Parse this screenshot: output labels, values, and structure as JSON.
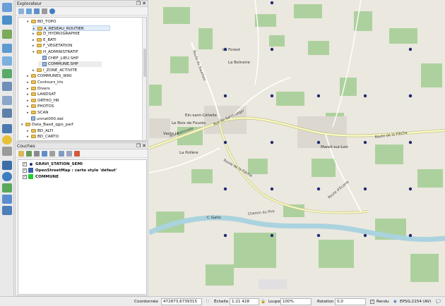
{
  "explorer": {
    "title": "Explorateur",
    "items": [
      {
        "label": "BD_TOPO",
        "indent": 1,
        "type": "folder",
        "arrow": "▾"
      },
      {
        "label": "A_RESEAU_ROUTIER",
        "indent": 2,
        "type": "folder",
        "arrow": "▸",
        "selected": true
      },
      {
        "label": "D_HYDROGRAPHIE",
        "indent": 2,
        "type": "folder",
        "arrow": "▸"
      },
      {
        "label": "E_BATI",
        "indent": 2,
        "type": "folder",
        "arrow": "▸"
      },
      {
        "label": "F_VEGETATION",
        "indent": 2,
        "type": "folder",
        "arrow": "▸"
      },
      {
        "label": "H_ADMINISTRATIF",
        "indent": 2,
        "type": "folder",
        "arrow": "▾"
      },
      {
        "label": "CHEF_LIEU.SHP",
        "indent": 3,
        "type": "file",
        "arrow": ""
      },
      {
        "label": "COMMUNE.SHP",
        "indent": 3,
        "type": "file",
        "arrow": "",
        "highlight": true
      },
      {
        "label": "I_ZONE_ACTIVITE",
        "indent": 2,
        "type": "folder",
        "arrow": "▸"
      },
      {
        "label": "COMMUNES_WIKI",
        "indent": 1,
        "type": "folder",
        "arrow": "▸"
      },
      {
        "label": "Contours_Iris",
        "indent": 1,
        "type": "folder",
        "arrow": "▸"
      },
      {
        "label": "Divers",
        "indent": 1,
        "type": "folder",
        "arrow": "▸"
      },
      {
        "label": "LANDSAT",
        "indent": 1,
        "type": "folder",
        "arrow": "▸"
      },
      {
        "label": "ORTHO_HR",
        "indent": 1,
        "type": "folder",
        "arrow": "▸"
      },
      {
        "label": "PHOTOS",
        "indent": 1,
        "type": "folder",
        "arrow": "▸"
      },
      {
        "label": "SCAN",
        "indent": 1,
        "type": "folder",
        "arrow": "▸"
      },
      {
        "label": "unnat000.dat",
        "indent": 1,
        "type": "file",
        "arrow": ""
      },
      {
        "label": "Data_Baed_qgis_parf",
        "indent": 0,
        "type": "folder",
        "arrow": "▾"
      },
      {
        "label": "BD_ALTI",
        "indent": 1,
        "type": "folder",
        "arrow": "▸"
      },
      {
        "label": "BD_CARTO",
        "indent": 1,
        "type": "folder",
        "arrow": "▸"
      }
    ]
  },
  "layers": {
    "title": "Couches",
    "items": [
      {
        "label": "GRAVI_STATION_SEMI",
        "indent": 0,
        "symbol": "point",
        "color": "#1f2a6e"
      },
      {
        "label": "OpenStreetMap : carte style 'défaut'",
        "indent": 0,
        "symbol": "raster",
        "color": "#3b5fa8"
      },
      {
        "label": "COMMUNE",
        "indent": 0,
        "symbol": "fill",
        "color": "#22cc33"
      }
    ]
  },
  "map": {
    "places": [
      {
        "label": "La Forest"
      },
      {
        "label": "La Bolnerie"
      },
      {
        "label": "Ein-sant-Céhelle"
      },
      {
        "label": "Le Bois de Fourès"
      },
      {
        "label": "Vaste la"
      },
      {
        "label": "La Pollère"
      },
      {
        "label": "Mareil-sur-Loir"
      },
      {
        "label": "C Gatis"
      }
    ],
    "roads": [
      {
        "label": "Route du Sauchon"
      },
      {
        "label": "Rue de Saint-Léger"
      },
      {
        "label": "Route de la Flèche"
      },
      {
        "label": "Route de la Flèche"
      },
      {
        "label": "Chemin du Pire"
      },
      {
        "label": "Route d'Ecarre"
      },
      {
        "label": "Rue Nationale"
      }
    ]
  },
  "status": {
    "coord_label": "Coordonnée",
    "coord_value": "472873,6739315",
    "scale_label": "Échelle",
    "scale_value": "1:21 428",
    "magnifier_label": "Loupe",
    "magnifier_value": "100%",
    "rotation_label": "Rotation",
    "rotation_value": "0,0",
    "render_label": "Rendu",
    "crs_label": "EPSG:2154 (AV)"
  },
  "colors": {
    "water": "#aad3df",
    "forest": "#add19e",
    "residential": "#dcd8d0",
    "road_major": "#f7fabf",
    "road_outline": "#c8c296",
    "point": "#1f2a6e"
  }
}
